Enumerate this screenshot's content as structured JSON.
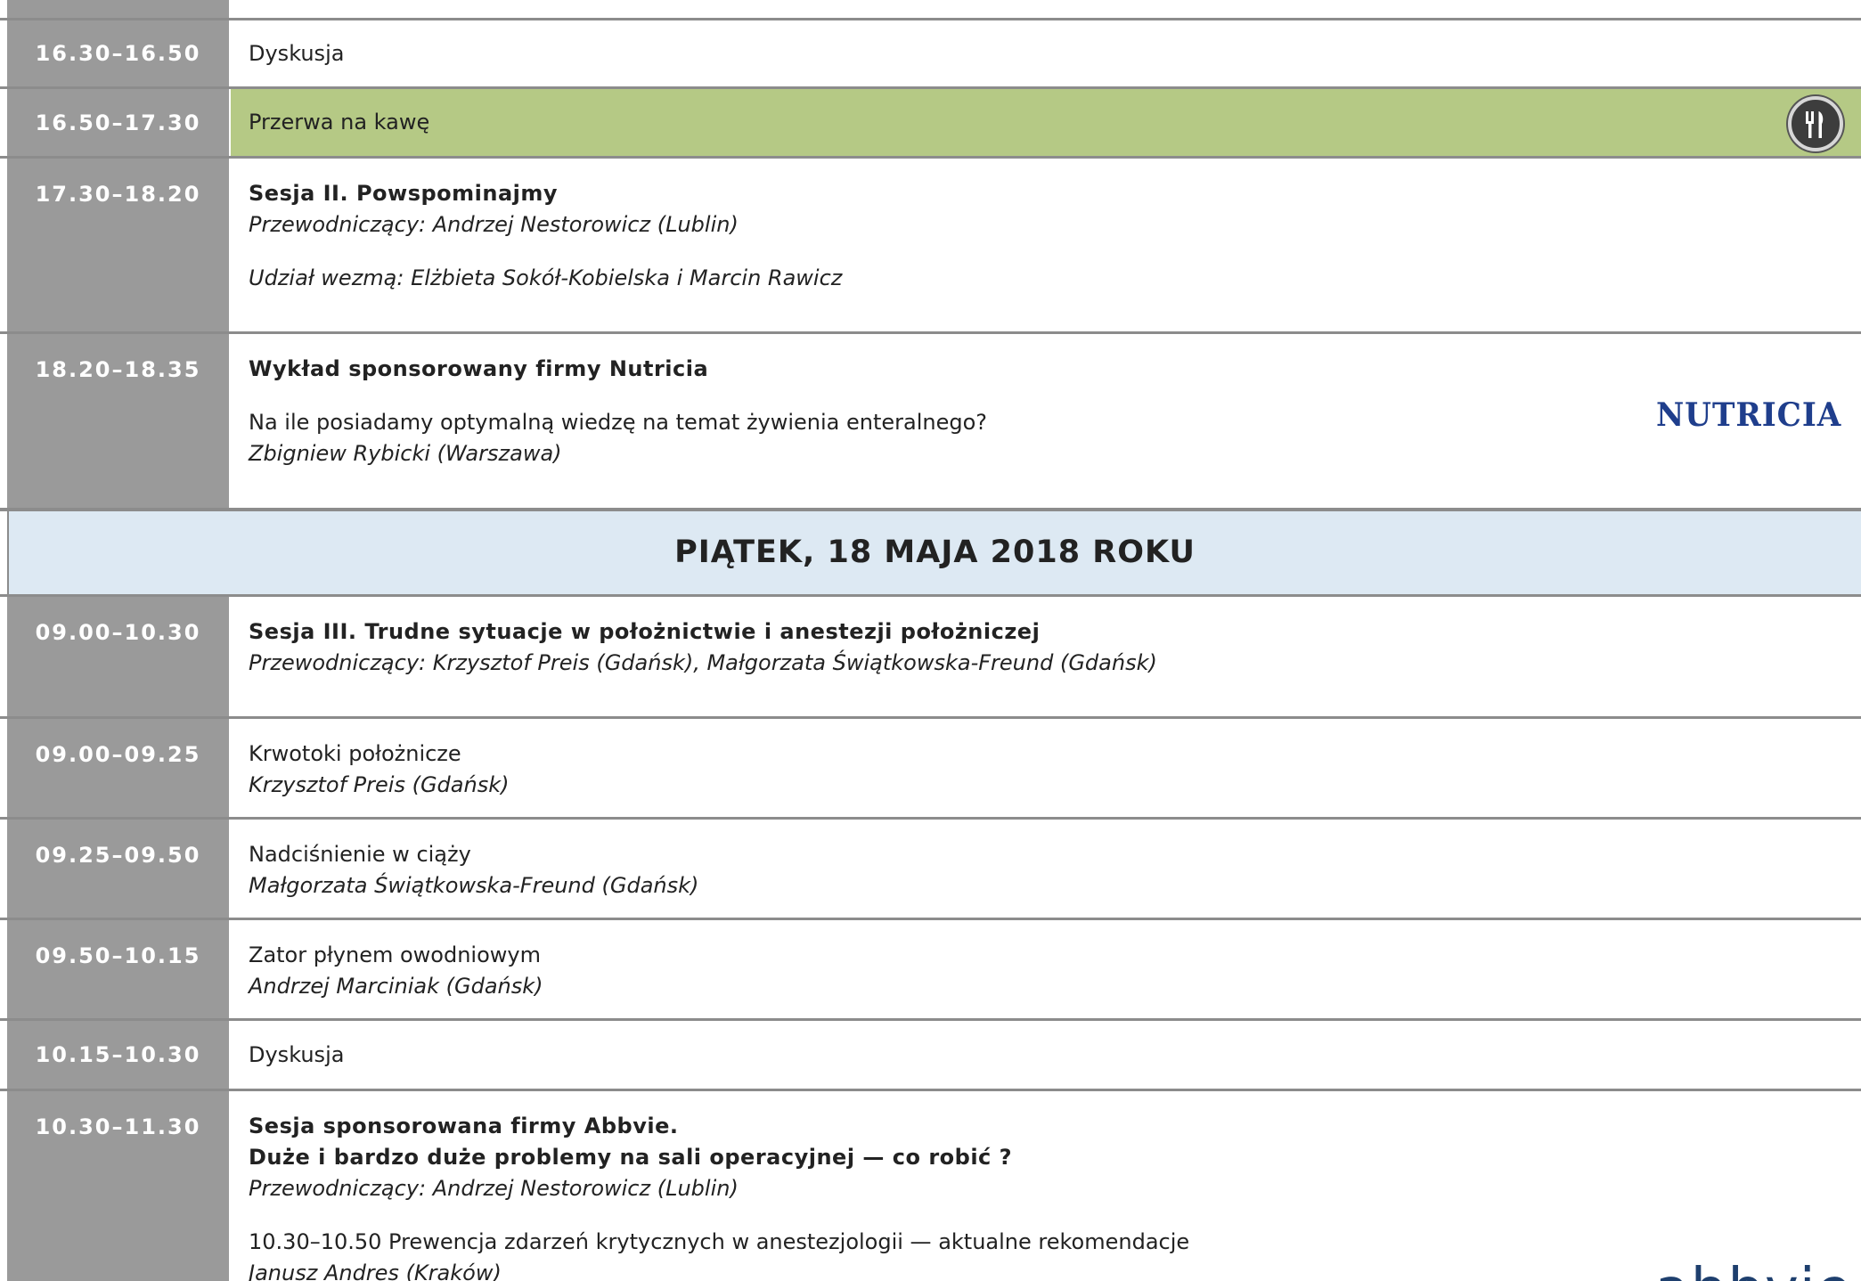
{
  "rows": [
    {
      "time": "16.30–16.50",
      "text": "Dyskusja"
    },
    {
      "time": "16.50–17.30",
      "text": "Przerwa na kawę",
      "icon": "cutlery-icon"
    },
    {
      "time": "17.30–18.20",
      "title": "Sesja II. Powspominajmy",
      "chair": "Przewodniczący: Andrzej Nestorowicz (Lublin)",
      "note": "Udział wezmą: Elżbieta Sokół-Kobielska i Marcin Rawicz"
    },
    {
      "time": "18.20–18.35",
      "title": "Wykład sponsorowany firmy Nutricia",
      "topic": "Na ile posiadamy optymalną wiedzę na temat żywienia enteralnego?",
      "speaker": "Zbigniew Rybicki (Warszawa)",
      "logo": "NUTRICIA"
    },
    {
      "day": "PIĄTEK, 18 MAJA 2018 ROKU"
    },
    {
      "time": "09.00–10.30",
      "title": "Sesja III. Trudne sytuacje w położnictwie i anestezji położniczej",
      "chair": "Przewodniczący: Krzysztof Preis (Gdańsk), Małgorzata Świątkowska-Freund (Gdańsk)"
    },
    {
      "time": "09.00–09.25",
      "topic": "Krwotoki położnicze",
      "speaker": "Krzysztof Preis (Gdańsk)"
    },
    {
      "time": "09.25–09.50",
      "topic": "Nadciśnienie w ciąży",
      "speaker": "Małgorzata Świątkowska-Freund (Gdańsk)"
    },
    {
      "time": "09.50–10.15",
      "topic": "Zator płynem owodniowym",
      "speaker": "Andrzej Marciniak (Gdańsk)"
    },
    {
      "time": "10.15–10.30",
      "text": "Dyskusja"
    },
    {
      "time": "10.30–11.30",
      "title": "Sesja sponsorowana firmy Abbvie.",
      "title2": "Duże i bardzo duże problemy na sali operacyjnej — co robić ?",
      "chair": "Przewodniczący: Andrzej Nestorowicz (Lublin)",
      "topic": "10.30–10.50 Prewencja zdarzeń krytycznych w anestezjologii — aktualne rekomendacje",
      "speaker": "Janusz Andres (Kraków)",
      "logo": "abbvie"
    }
  ]
}
